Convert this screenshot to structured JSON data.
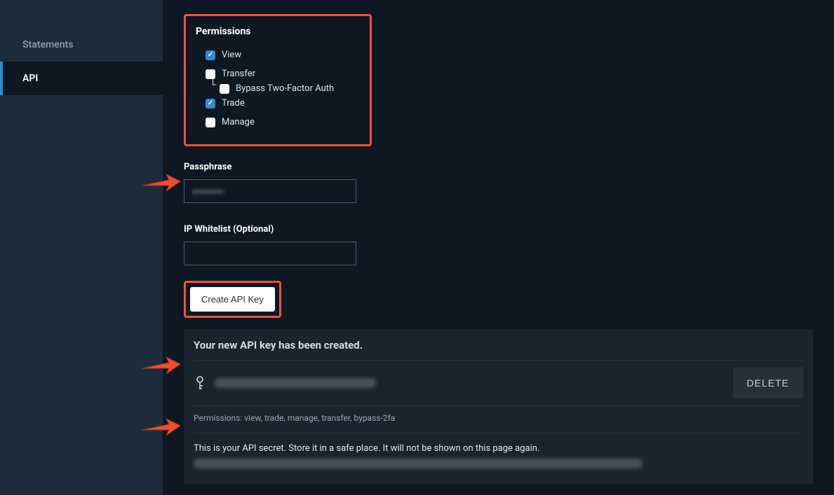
{
  "sidebar": {
    "items": [
      {
        "label": "Statements"
      },
      {
        "label": "API"
      }
    ]
  },
  "permissions": {
    "title": "Permissions",
    "view": {
      "label": "View",
      "checked": true
    },
    "transfer": {
      "label": "Transfer",
      "checked": false
    },
    "bypass2fa": {
      "label": "Bypass Two-Factor Auth",
      "checked": false
    },
    "trade": {
      "label": "Trade",
      "checked": true
    },
    "manage": {
      "label": "Manage",
      "checked": false
    }
  },
  "passphrase": {
    "label": "Passphrase",
    "value": "••••••••••"
  },
  "whitelist": {
    "label": "IP Whitelist (Optional)",
    "value": ""
  },
  "buttons": {
    "create": "Create API Key",
    "delete": "DELETE"
  },
  "result": {
    "title": "Your new API key has been created.",
    "perm_summary": "Permissions: view, trade, manage, transfer, bypass-2fa",
    "secret_notice": "This is your API secret. Store it in a safe place. It will not be shown on this page again."
  }
}
